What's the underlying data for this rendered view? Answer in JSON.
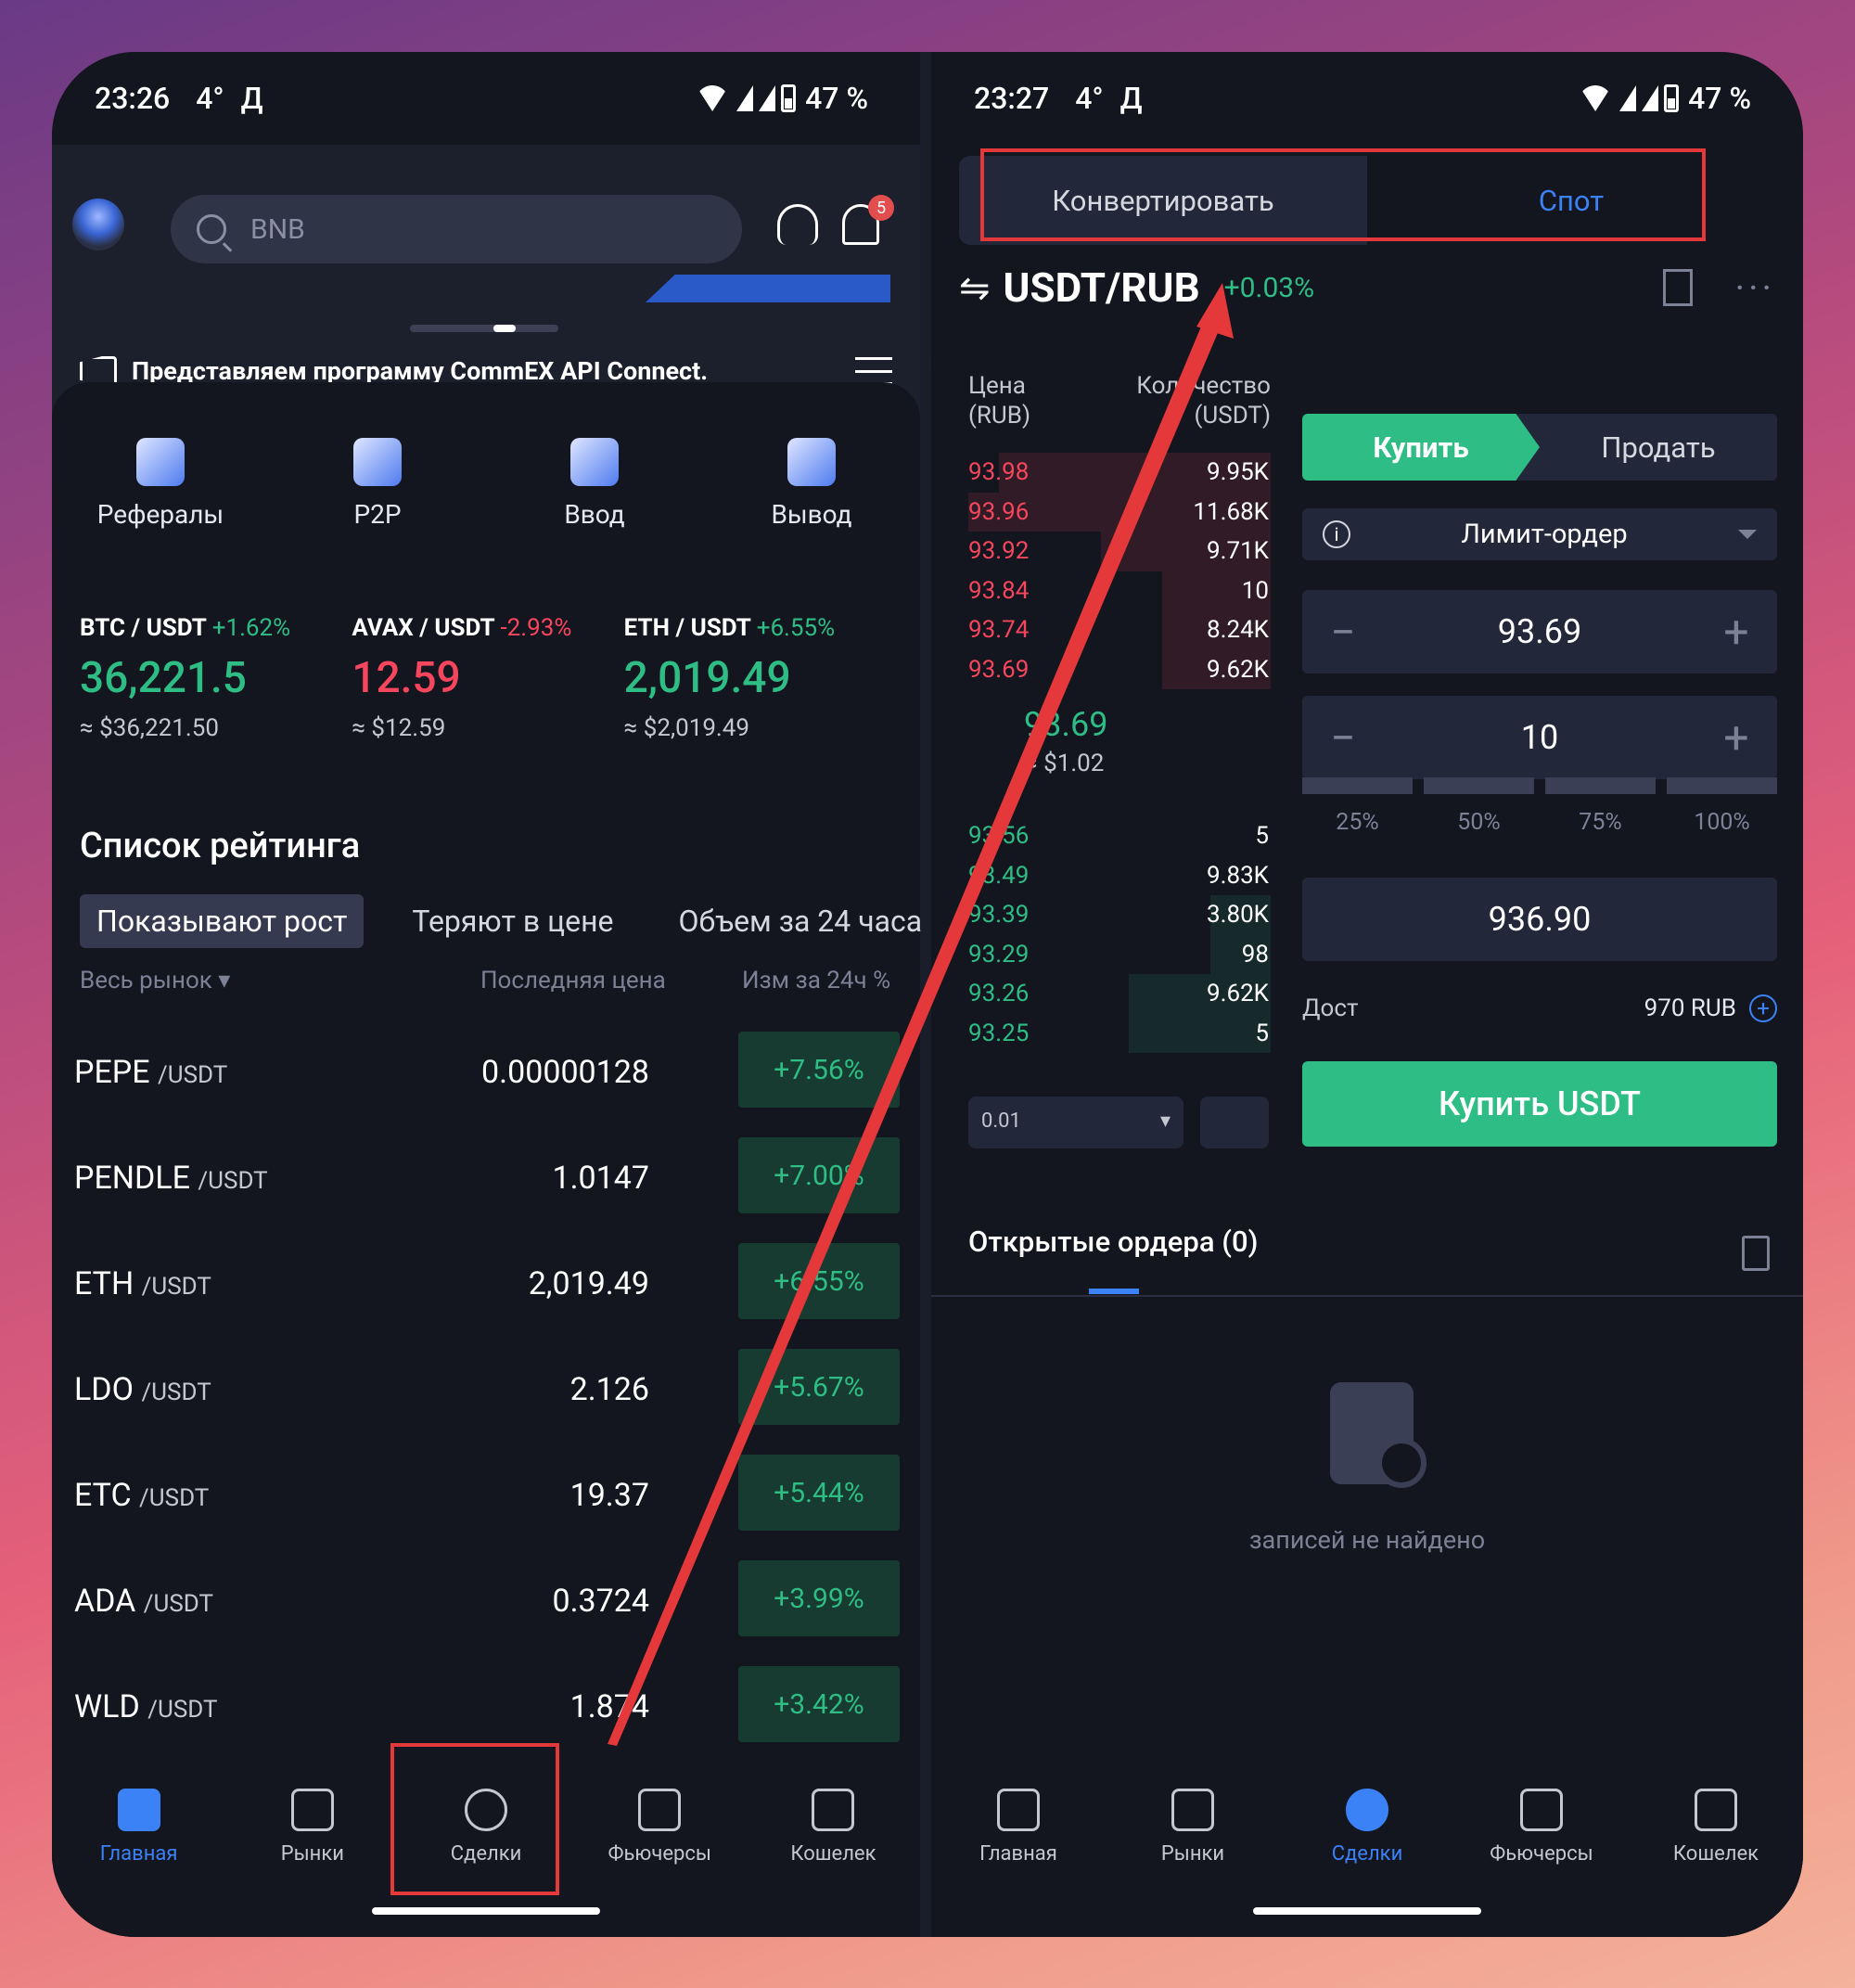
{
  "left": {
    "status": {
      "time": "23:26",
      "temp": "4°",
      "letter": "Д",
      "battery": "47 %"
    },
    "search_placeholder": "BNB",
    "notif_count": "5",
    "announcement": "Представляем программу CommEX API Connect.",
    "shortcuts": [
      {
        "label": "Рефералы",
        "icon": "referral-icon"
      },
      {
        "label": "P2P",
        "icon": "p2p-icon"
      },
      {
        "label": "Ввод",
        "icon": "deposit-icon"
      },
      {
        "label": "Вывод",
        "icon": "withdraw-icon"
      }
    ],
    "tickers": [
      {
        "pair": "BTC / USDT",
        "change": "+1.62%",
        "price": "36,221.5",
        "approx": "≈ $36,221.50",
        "dir": "up"
      },
      {
        "pair": "AVAX / USDT",
        "change": "-2.93%",
        "price": "12.59",
        "approx": "≈ $12.59",
        "dir": "down"
      },
      {
        "pair": "ETH / USDT",
        "change": "+6.55%",
        "price": "2,019.49",
        "approx": "≈ $2,019.49",
        "dir": "up"
      }
    ],
    "rating_title": "Список рейтинга",
    "rating_tabs": [
      "Показывают рост",
      "Теряют в цене",
      "Объем за 24 часа"
    ],
    "rating_header": {
      "market": "Весь рынок",
      "last_price": "Последняя цена",
      "change": "Изм за 24ч %"
    },
    "rows": [
      {
        "sym": "PEPE",
        "quote": "/USDT",
        "price": "0.00000128",
        "change": "+7.56%"
      },
      {
        "sym": "PENDLE",
        "quote": "/USDT",
        "price": "1.0147",
        "change": "+7.00%"
      },
      {
        "sym": "ETH",
        "quote": "/USDT",
        "price": "2,019.49",
        "change": "+6.55%"
      },
      {
        "sym": "LDO",
        "quote": "/USDT",
        "price": "2.126",
        "change": "+5.67%"
      },
      {
        "sym": "ETC",
        "quote": "/USDT",
        "price": "19.37",
        "change": "+5.44%"
      },
      {
        "sym": "ADA",
        "quote": "/USDT",
        "price": "0.3724",
        "change": "+3.99%"
      },
      {
        "sym": "WLD",
        "quote": "/USDT",
        "price": "1.874",
        "change": "+3.42%"
      }
    ],
    "tabbar": [
      {
        "label": "Главная",
        "active": true
      },
      {
        "label": "Рынки"
      },
      {
        "label": "Сделки"
      },
      {
        "label": "Фьючерсы"
      },
      {
        "label": "Кошелек"
      }
    ]
  },
  "right": {
    "status": {
      "time": "23:27",
      "temp": "4°",
      "letter": "Д",
      "battery": "47 %"
    },
    "segment": [
      "Конвертировать",
      "Спот"
    ],
    "pair": "USDT/RUB",
    "pair_change": "+0.03%",
    "ob_header": {
      "price": "Цена\n(RUB)",
      "qty": "Количество\n(USDT)"
    },
    "asks": [
      {
        "p": "93.98",
        "q": "9.95K",
        "depth": 0.9
      },
      {
        "p": "93.96",
        "q": "11.68K",
        "depth": 1.0
      },
      {
        "p": "93.92",
        "q": "9.71K",
        "depth": 0.56
      },
      {
        "p": "93.84",
        "q": "10",
        "depth": 0.36
      },
      {
        "p": "93.74",
        "q": "8.24K",
        "depth": 0.36
      },
      {
        "p": "93.69",
        "q": "9.62K",
        "depth": 0.36
      }
    ],
    "mid_price": "93.69",
    "mid_usd": "≈ $1.02",
    "bids": [
      {
        "p": "93.56",
        "q": "5",
        "depth": 0.0
      },
      {
        "p": "93.49",
        "q": "9.83K",
        "depth": 0.0
      },
      {
        "p": "93.39",
        "q": "3.80K",
        "depth": 0.2
      },
      {
        "p": "93.29",
        "q": "98",
        "depth": 0.2
      },
      {
        "p": "93.26",
        "q": "9.62K",
        "depth": 0.47
      },
      {
        "p": "93.25",
        "q": "5",
        "depth": 0.47
      }
    ],
    "precision": "0.01",
    "buy_label": "Купить",
    "sell_label": "Продать",
    "order_type": "Лимит-ордер",
    "price_val": "93.69",
    "qty_val": "10",
    "pcts": [
      "25%",
      "50%",
      "75%",
      "100%"
    ],
    "total": "936.90",
    "avail_label": "Дост",
    "avail_val": "970 RUB",
    "buy_button": "Купить USDT",
    "open_orders": "Открытые ордера (0)",
    "empty": "записей не найдено",
    "tabbar": [
      {
        "label": "Главная"
      },
      {
        "label": "Рынки"
      },
      {
        "label": "Сделки",
        "active": true
      },
      {
        "label": "Фьючерсы"
      },
      {
        "label": "Кошелек"
      }
    ]
  },
  "colors": {
    "green": "#2ebd85",
    "red": "#f6465d",
    "blue": "#3b82f6",
    "annotation": "#e5383b"
  }
}
